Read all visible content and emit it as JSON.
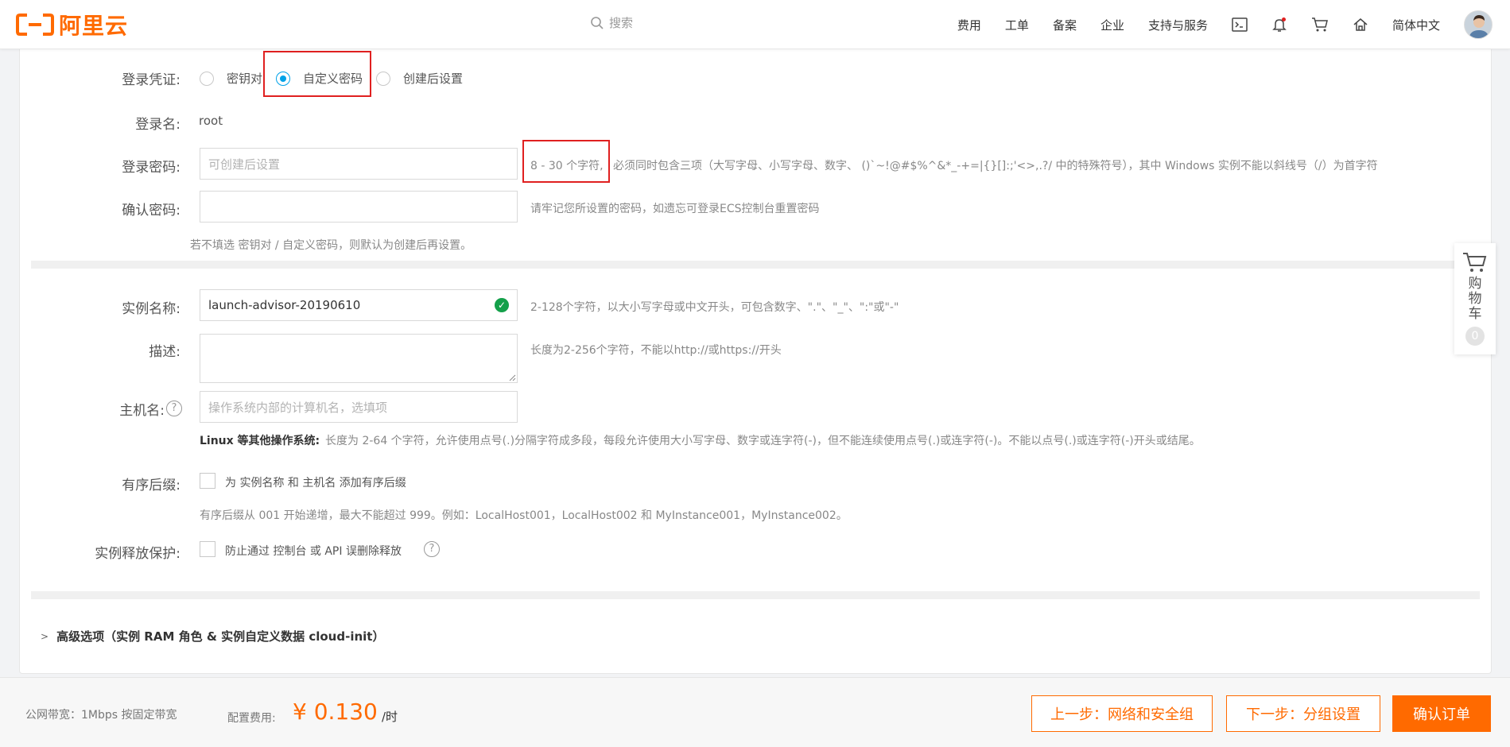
{
  "header": {
    "logo_text": "阿里云",
    "search_placeholder": "搜索",
    "nav": [
      "费用",
      "工单",
      "备案",
      "企业",
      "支持与服务"
    ],
    "language": "简体中文",
    "icons": [
      "terminal-icon",
      "bell-icon",
      "cart-icon",
      "home-icon"
    ]
  },
  "login": {
    "credential_label": "登录凭证:",
    "options": [
      "密钥对",
      "自定义密码",
      "创建后设置"
    ],
    "selected": "自定义密码",
    "username_label": "登录名:",
    "username_value": "root",
    "password_label": "登录密码:",
    "password_placeholder": "可创建后设置",
    "password_hint_highlight": "8 - 30 个字符,",
    "password_hint_rest": "必须同时包含三项（大写字母、小写字母、数字、 ()`~!@#$%^&*_-+=|{}[]:;'<>,.?/ 中的特殊符号），其中 Windows 实例不能以斜线号（/）为首字符",
    "confirm_label": "确认密码:",
    "confirm_hint": "请牢记您所设置的密码，如遗忘可登录ECS控制台重置密码",
    "note": "若不填选 密钥对 / 自定义密码，则默认为创建后再设置。"
  },
  "instance": {
    "name_label": "实例名称:",
    "name_value": "launch-advisor-20190610",
    "name_hint": "2-128个字符，以大小写字母或中文开头，可包含数字、\".\"、\"_\"、\":\"或\"-\"",
    "desc_label": "描述:",
    "desc_hint": "长度为2-256个字符，不能以http://或https://开头",
    "hostname_label": "主机名:",
    "hostname_placeholder": "操作系统内部的计算机名，选填项",
    "hostname_hint_bold": "Linux 等其他操作系统:",
    "hostname_hint": "长度为 2-64 个字符，允许使用点号(.)分隔字符成多段，每段允许使用大小写字母、数字或连字符(-)，但不能连续使用点号(.)或连字符(-)。不能以点号(.)或连字符(-)开头或结尾。",
    "suffix_label": "有序后缀:",
    "suffix_option": "为 实例名称 和 主机名 添加有序后缀",
    "suffix_note": "有序后缀从 001 开始递增，最大不能超过 999。例如：LocalHost001，LocalHost002 和 MyInstance001，MyInstance002。",
    "protect_label": "实例释放保护:",
    "protect_option": "防止通过 控制台 或 API 误删除释放"
  },
  "advanced": {
    "label": "高级选项（实例 RAM 角色 & 实例自定义数据 cloud-init）"
  },
  "float_cart": {
    "label": "购物车",
    "count": "0"
  },
  "footer": {
    "bandwidth": "公网带宽：1Mbps 按固定带宽",
    "cost_label": "配置费用:",
    "price": "¥ 0.130",
    "unit": "/时",
    "prev_button": "上一步：网络和安全组",
    "next_button": "下一步：分组设置",
    "confirm_button": "确认订单"
  },
  "colors": {
    "brand": "#ff6a00",
    "radio_selected": "#00a2e8",
    "highlight_box": "#e02020",
    "valid_check": "#14a04a"
  }
}
